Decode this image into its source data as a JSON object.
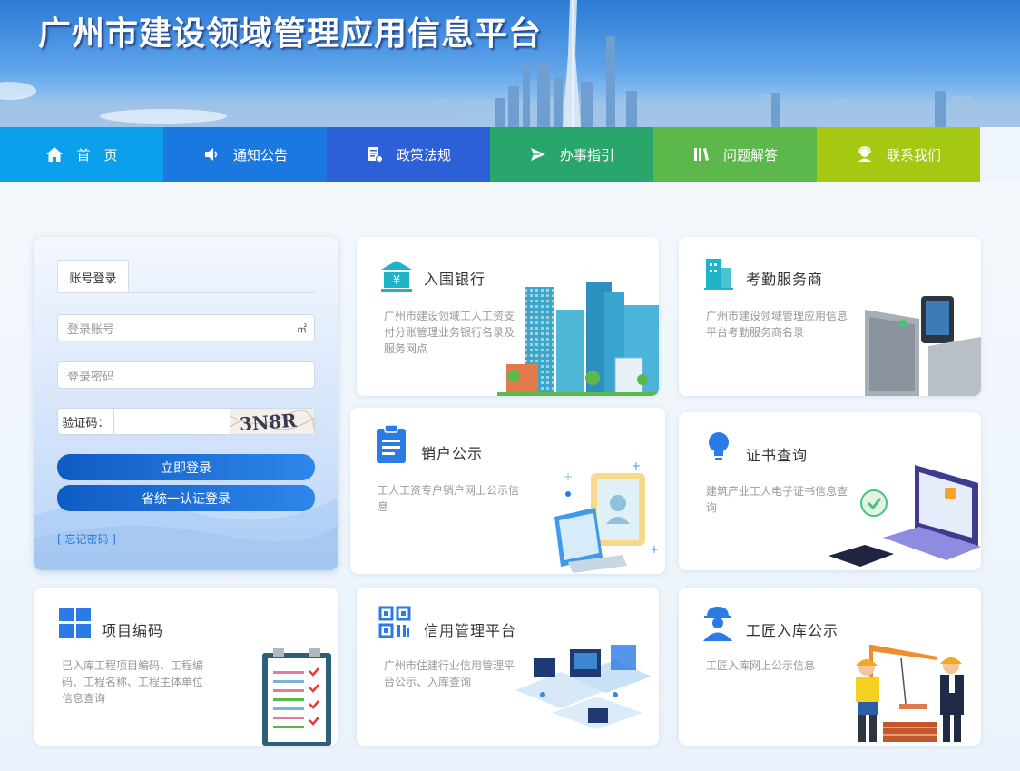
{
  "banner": {
    "title": "广州市建设领域管理应用信息平台"
  },
  "nav": {
    "items": [
      {
        "label": "首　页",
        "icon": "home-icon",
        "color": "#0aa0ec"
      },
      {
        "label": "通知公告",
        "icon": "speaker-icon",
        "color": "#1a78e0"
      },
      {
        "label": "政策法规",
        "icon": "document-icon",
        "color": "#2d5fd6"
      },
      {
        "label": "办事指引",
        "icon": "paper-plane-icon",
        "color": "#28a66b"
      },
      {
        "label": "问题解答",
        "icon": "books-icon",
        "color": "#5cb84a"
      },
      {
        "label": "联系我们",
        "icon": "support-agent-icon",
        "color": "#a5c812"
      }
    ]
  },
  "login": {
    "tab_label": "账号登录",
    "account_placeholder": "登录账号",
    "password_placeholder": "登录密码",
    "captcha_label": "验证码：",
    "captcha_text": "3N8R",
    "login_button": "立即登录",
    "unified_login_button": "省统一认证登录",
    "forgot_link": "[ 忘记密码 ]"
  },
  "cards": {
    "bank": {
      "title": "入围银行",
      "desc": "广州市建设领域工人工资支付分账管理业务银行名录及服务网点"
    },
    "attendance": {
      "title": "考勤服务商",
      "desc": "广州市建设领域管理应用信息平台考勤服务商名录"
    },
    "cancel": {
      "title": "销户公示",
      "desc": "工人工资专户销户网上公示信息"
    },
    "certificate": {
      "title": "证书查询",
      "desc": "建筑产业工人电子证书信息查询"
    },
    "project": {
      "title": "项目编码",
      "desc": "已入库工程项目编码、工程编码、工程名称、工程主体单位信息查询"
    },
    "credit": {
      "title": "信用管理平台",
      "desc": "广州市住建行业信用管理平台公示、入库查询"
    },
    "craftsman": {
      "title": "工匠入库公示",
      "desc": "工匠入库网上公示信息"
    }
  },
  "colors": {
    "accent": "#1a78e0",
    "icon_teal": "#1fb3c8",
    "icon_blue": "#2a7be6"
  }
}
